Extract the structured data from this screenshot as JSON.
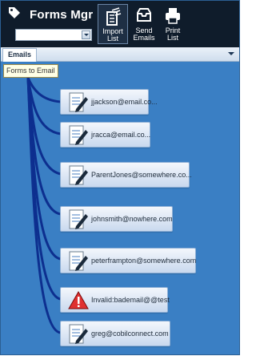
{
  "header": {
    "title": "Forms Mgr",
    "combo_value": "",
    "tools": [
      {
        "line1": "Import",
        "line2": "List",
        "icon": "import-list-icon"
      },
      {
        "line1": "Send",
        "line2": "Emails",
        "icon": "inbox-icon"
      },
      {
        "line1": "Print",
        "line2": "List",
        "icon": "printer-icon"
      }
    ]
  },
  "tabs": {
    "active": "Emails"
  },
  "tooltip": "Forms to Email",
  "tree": {
    "items": [
      {
        "label": "jjackson@email.co...",
        "status": "ok"
      },
      {
        "label": "jracca@email.co...",
        "status": "ok"
      },
      {
        "label": "ParentJones@somewhere.co...",
        "status": "ok"
      },
      {
        "label": "johnsmith@nowhere.com",
        "status": "ok"
      },
      {
        "label": "peterframpton@somewhere.com",
        "status": "ok"
      },
      {
        "label": "Invalid:bademail@@test",
        "status": "invalid"
      },
      {
        "label": "greg@cobilconnect.com",
        "status": "ok"
      }
    ]
  },
  "colors": {
    "background": "#3a7fc4",
    "header": "#0f1c2b",
    "connector": "#0d2f8f",
    "warning": "#e03030"
  }
}
